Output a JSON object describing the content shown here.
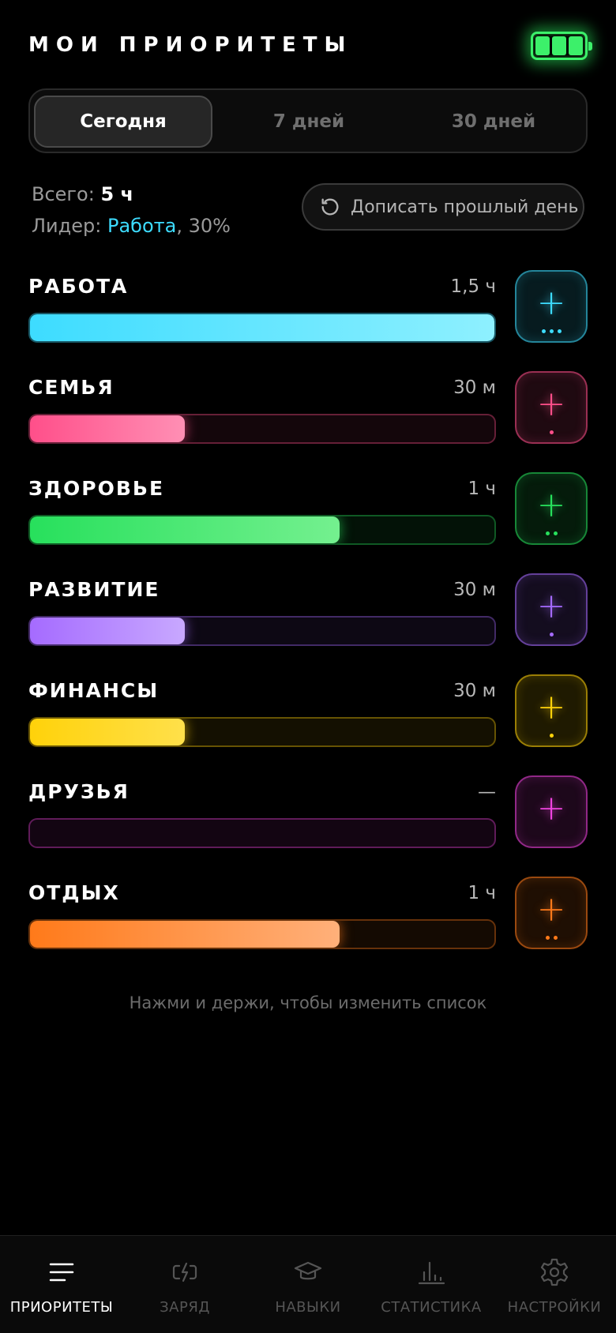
{
  "header": {
    "title": "МОИ ПРИОРИТЕТЫ",
    "battery_icon": "battery-full-icon",
    "battery_color": "#3cf06a"
  },
  "periods": [
    {
      "label": "Сегодня",
      "active": true
    },
    {
      "label": "7 дней",
      "active": false
    },
    {
      "label": "30 дней",
      "active": false
    }
  ],
  "summary": {
    "total_label": "Всего:",
    "total_value": "5 ч",
    "leader_label": "Лидер:",
    "leader_name": "Работа",
    "leader_share": ", 30%"
  },
  "back_button": {
    "label": "Дописать прошлый день",
    "icon": "history-icon"
  },
  "categories": [
    {
      "name": "РАБОТА",
      "time": "1,5 ч",
      "fraction": 1.0,
      "dots": 3,
      "color": "#3ddcff",
      "color_end": "#8ef0ff"
    },
    {
      "name": "СЕМЬЯ",
      "time": "30 м",
      "fraction": 0.333,
      "dots": 1,
      "color": "#ff4f8a",
      "color_end": "#ff8fb4"
    },
    {
      "name": "ЗДОРОВЬЕ",
      "time": "1 ч",
      "fraction": 0.667,
      "dots": 2,
      "color": "#27e05c",
      "color_end": "#74f08f"
    },
    {
      "name": "РАЗВИТИЕ",
      "time": "30 м",
      "fraction": 0.333,
      "dots": 1,
      "color": "#a56bff",
      "color_end": "#c8a8ff"
    },
    {
      "name": "ФИНАНСЫ",
      "time": "30 м",
      "fraction": 0.333,
      "dots": 1,
      "color": "#ffd20a",
      "color_end": "#ffe04a"
    },
    {
      "name": "ДРУЗЬЯ",
      "time": "—",
      "fraction": 0,
      "dots": 0,
      "color": "#f044e0",
      "color_end": "#f58de9"
    },
    {
      "name": "ОТДЫХ",
      "time": "1 ч",
      "fraction": 0.667,
      "dots": 2,
      "color": "#ff7a1a",
      "color_end": "#ffb07a"
    }
  ],
  "add_icon": "plus-icon",
  "hint": "Нажми и держи, чтобы изменить список",
  "tabs": [
    {
      "label": "ПРИОРИТЕТЫ",
      "icon": "list-icon",
      "active": true
    },
    {
      "label": "ЗАРЯД",
      "icon": "charge-icon",
      "active": false
    },
    {
      "label": "НАВЫКИ",
      "icon": "graduation-cap-icon",
      "active": false
    },
    {
      "label": "СТАТИСТИКА",
      "icon": "bar-chart-icon",
      "active": false
    },
    {
      "label": "НАСТРОЙКИ",
      "icon": "gear-icon",
      "active": false
    }
  ]
}
